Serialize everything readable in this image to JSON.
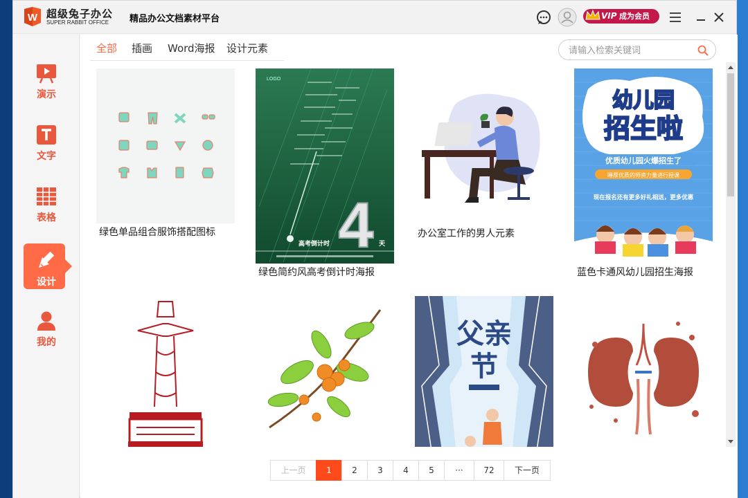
{
  "app": {
    "brand_cn": "超级兔子办公",
    "brand_en": "SUPER RABBIT OFFICE",
    "platform_title": "精品办公文档素材平台",
    "logo_letter": "W",
    "vip_label": "VIP",
    "vip_cta": "成为会员"
  },
  "sidebar": {
    "items": [
      {
        "label": "演示",
        "icon": "presentation-icon"
      },
      {
        "label": "文字",
        "icon": "text-doc-icon"
      },
      {
        "label": "表格",
        "icon": "table-icon"
      },
      {
        "label": "设计",
        "icon": "design-pen-icon",
        "active": true
      },
      {
        "label": "我的",
        "icon": "user-icon"
      }
    ]
  },
  "tabs": [
    {
      "label": "全部",
      "active": true
    },
    {
      "label": "插画"
    },
    {
      "label": "Word海报"
    },
    {
      "label": "设计元素"
    }
  ],
  "search": {
    "placeholder": "请输入检索关键词",
    "value": ""
  },
  "cards": [
    {
      "caption": "绿色单品组合服饰搭配图标"
    },
    {
      "caption": "绿色简约风高考倒计时海报"
    },
    {
      "caption": "办公室工作的男人元素"
    },
    {
      "caption": "蓝色卡通风幼儿园招生海报"
    },
    {
      "caption": ""
    },
    {
      "caption": ""
    },
    {
      "caption": ""
    },
    {
      "caption": ""
    }
  ],
  "poster_text": {
    "countdown_number": "4",
    "countdown_title": "高考倒计时",
    "countdown_unit": "天",
    "countdown_logo": "LOGO",
    "kinder_line1": "幼儿园",
    "kinder_line2": "招生啦",
    "kinder_banner": "优质幼儿园火爆招生了",
    "kinder_pill": "睡厚优质的师资力量进行授课",
    "kinder_bottom": "现在报名还有更多好礼相送，更多优惠",
    "father_title1": "父亲",
    "father_title2": "节"
  },
  "pagination": {
    "prev": "上一页",
    "pages": [
      "1",
      "2",
      "3",
      "4",
      "5",
      "···",
      "72"
    ],
    "current": "1",
    "next": "下一页"
  },
  "colors": {
    "accent": "#ff6a47",
    "page_active": "#ff4a1c",
    "vip": "#c2184a"
  }
}
